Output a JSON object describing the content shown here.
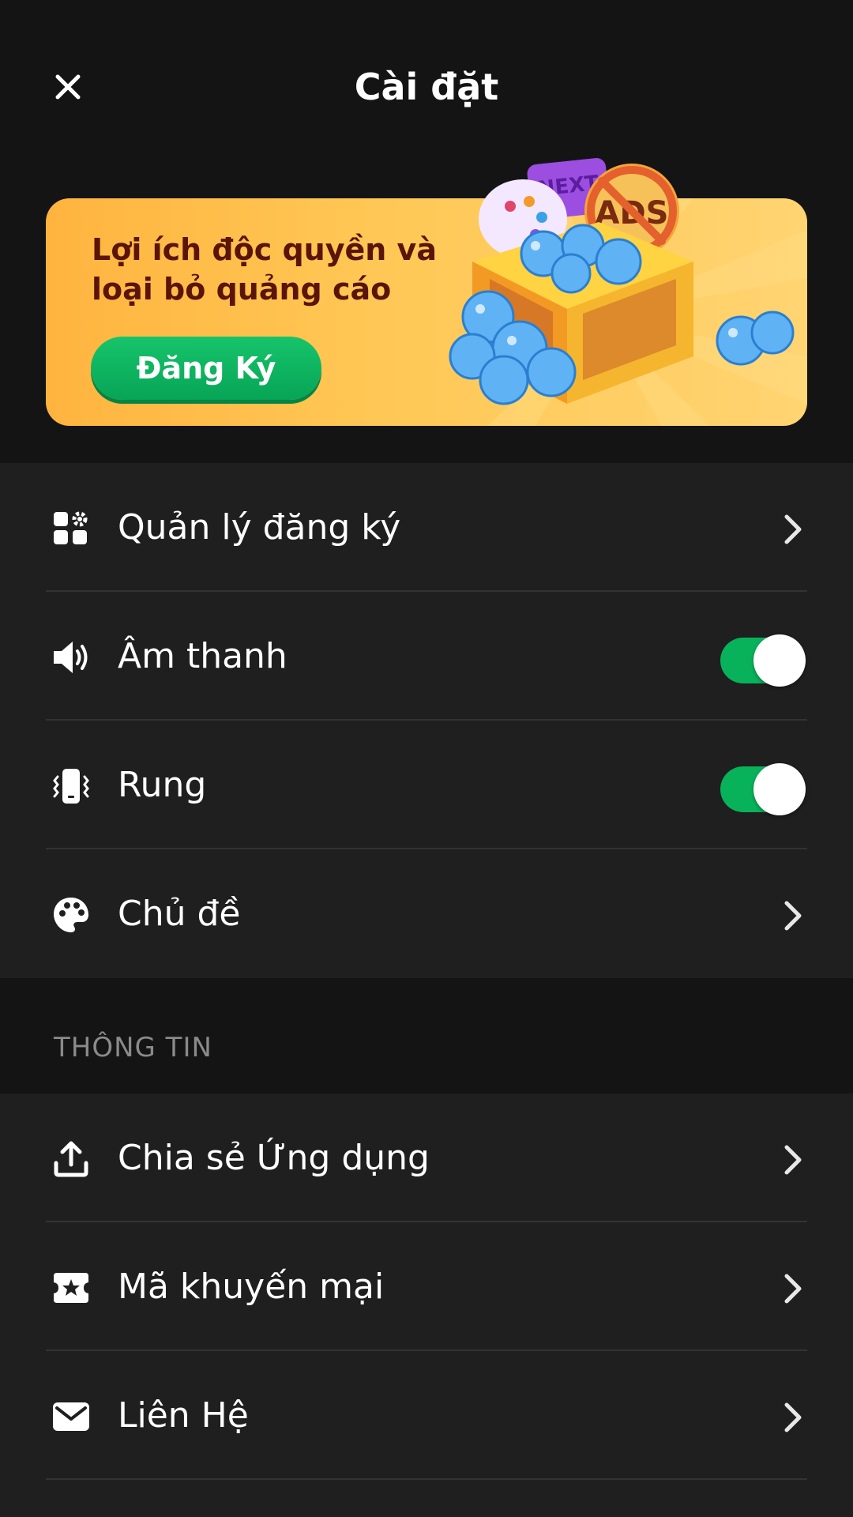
{
  "header": {
    "title": "Cài đặt"
  },
  "banner": {
    "text": "Lợi ích độc quyền và loại bỏ quảng cáo",
    "cta_label": "Đăng Ký",
    "art": {
      "next_tag": "NEXT",
      "ads_sign": "ADS"
    }
  },
  "settings": {
    "items": [
      {
        "label": "Quản lý đăng ký",
        "icon": "subscription-grid-icon",
        "control": "chevron"
      },
      {
        "label": "Âm thanh",
        "icon": "speaker-icon",
        "control": "toggle",
        "on": true
      },
      {
        "label": "Rung",
        "icon": "vibrate-icon",
        "control": "toggle",
        "on": true
      },
      {
        "label": "Chủ đề",
        "icon": "palette-icon",
        "control": "chevron"
      }
    ]
  },
  "info": {
    "heading": "THÔNG TIN",
    "items": [
      {
        "label": "Chia sẻ Ứng dụng",
        "icon": "share-upload-icon",
        "control": "chevron"
      },
      {
        "label": "Mã khuyến mại",
        "icon": "coupon-ticket-icon",
        "control": "chevron"
      },
      {
        "label": "Liên Hệ",
        "icon": "mail-icon",
        "control": "chevron"
      }
    ]
  },
  "colors": {
    "background": "#141414",
    "row_background": "#1f1f1f",
    "accent_green": "#08b25a",
    "banner_yellow": "#ffc856",
    "banner_text": "#5a1408"
  }
}
